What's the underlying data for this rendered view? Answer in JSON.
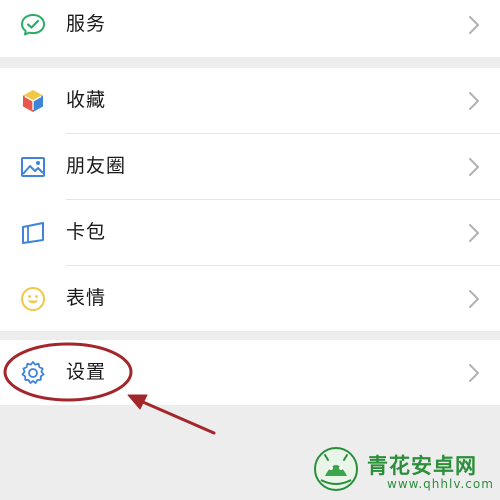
{
  "menu": {
    "items": [
      {
        "key": "services",
        "label": "服务",
        "icon": "services-icon"
      },
      {
        "key": "favorites",
        "label": "收藏",
        "icon": "cube-icon"
      },
      {
        "key": "moments",
        "label": "朋友圈",
        "icon": "picture-icon"
      },
      {
        "key": "cards",
        "label": "卡包",
        "icon": "card-icon"
      },
      {
        "key": "stickers",
        "label": "表情",
        "icon": "smile-icon"
      },
      {
        "key": "settings",
        "label": "设置",
        "icon": "gear-icon"
      }
    ],
    "chevron_icon": "chevron-right-icon"
  },
  "annotation": {
    "highlight_target": "settings",
    "color": "#a3262a"
  },
  "watermark": {
    "title": "青花安卓网",
    "url": "www.qhhlv.com",
    "color": "#2b8f3a"
  },
  "colors": {
    "background": "#ededed",
    "row_background": "#ffffff",
    "wechat_green": "#2aae67",
    "text": "#1a1a1a",
    "chevron": "#b2b2b2"
  }
}
